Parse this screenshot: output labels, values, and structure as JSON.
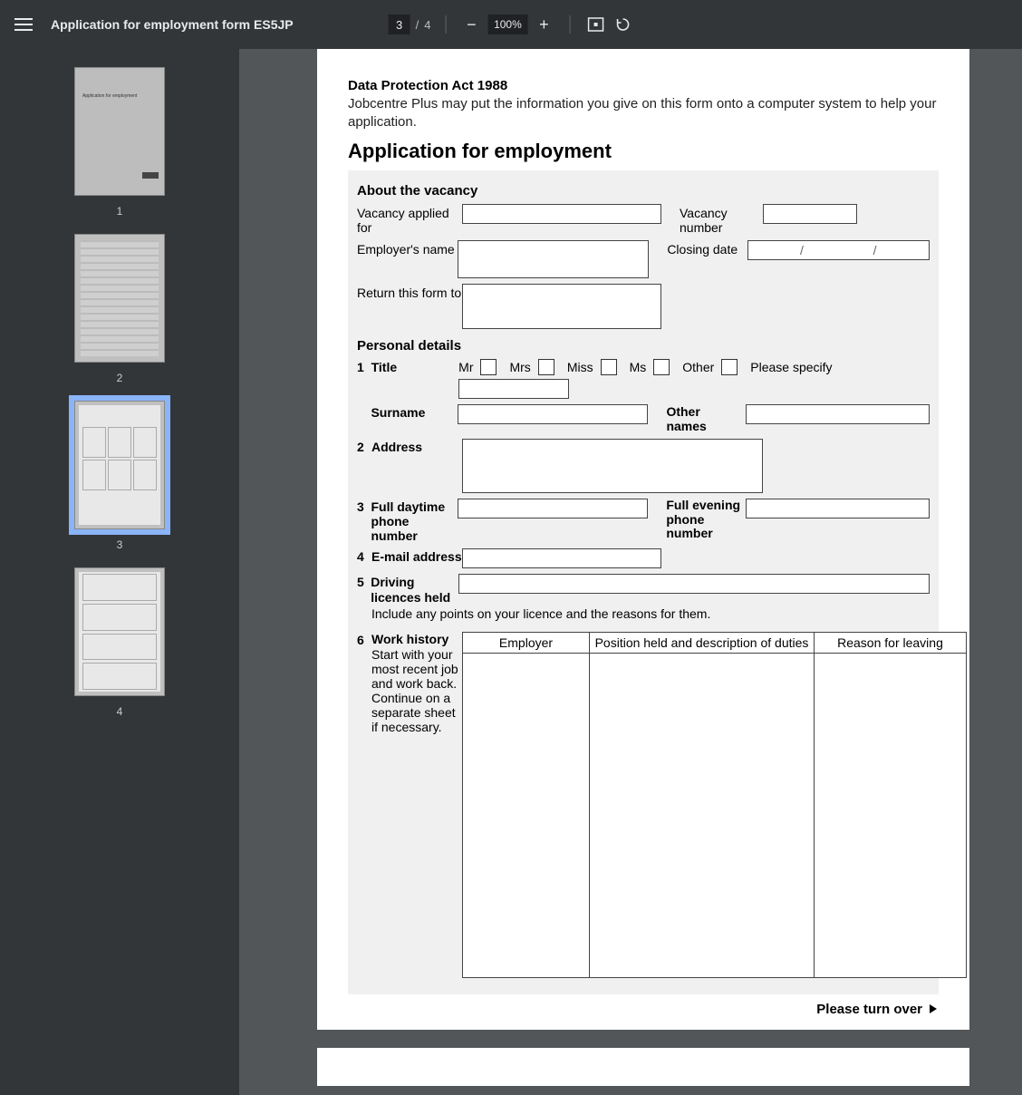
{
  "toolbar": {
    "title": "Application for employment form ES5JP",
    "page_current": "3",
    "page_total": "4",
    "page_sep": "/",
    "zoom": "100%"
  },
  "thumbs": {
    "p1": "1",
    "p2": "2",
    "p3": "3",
    "p4": "4",
    "t1_text": "Application for employment"
  },
  "doc": {
    "dp_head": "Data Protection Act 1988",
    "dp_body": "Jobcentre Plus may put the information you give on this form onto a computer system to help your application.",
    "app_title": "Application for employment",
    "sec_vacancy": "About the vacancy",
    "vacancy_applied": "Vacancy applied for",
    "vacancy_number": "Vacancy number",
    "employer_name": "Employer's name",
    "closing_date": "Closing date",
    "date_slash": "/",
    "return_to": "Return this form to",
    "sec_personal": "Personal details",
    "n1": "1",
    "title_lbl": "Title",
    "mr": "Mr",
    "mrs": "Mrs",
    "miss": "Miss",
    "ms": "Ms",
    "other": "Other",
    "specify": "Please specify",
    "surname": "Surname",
    "other_names": "Other names",
    "n2": "2",
    "address": "Address",
    "n3": "3",
    "day_phone": "Full daytime phone number",
    "eve_phone": "Full evening phone number",
    "n4": "4",
    "email": "E-mail address",
    "n5": "5",
    "licences": "Driving licences held",
    "licence_note": "Include any points on your licence and the reasons for them.",
    "n6": "6",
    "work_history": "Work history",
    "work_sub": "Start with your most recent job and work back. Continue on a separate sheet if necessary.",
    "col_employer": "Employer",
    "col_position": "Position held and description of duties",
    "col_reason": "Reason for leaving",
    "turn_over": "Please turn over"
  }
}
